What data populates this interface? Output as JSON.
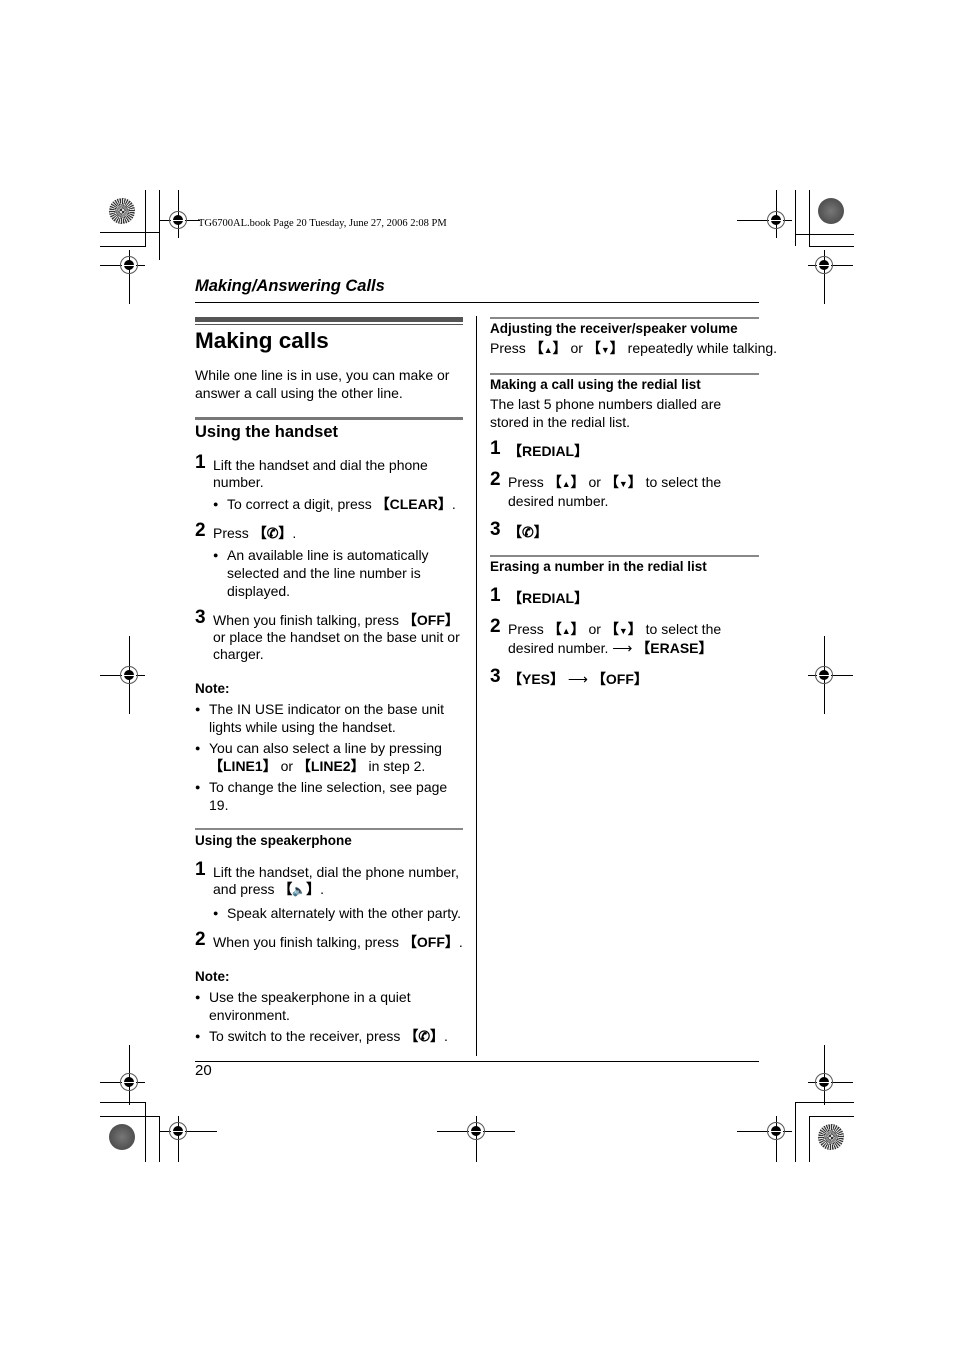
{
  "print_header": "TG6700AL.book  Page 20  Tuesday, June 27, 2006  2:08 PM",
  "section_title": "Making/Answering Calls",
  "page_title": "Making calls",
  "intro": "While one line is in use, you can make or answer a call using the other line.",
  "handset": {
    "heading": "Using the handset",
    "steps": [
      {
        "num": "1",
        "text": "Lift the handset and dial the phone number.",
        "bullets": [
          "To correct a digit, press [CLEAR]."
        ]
      },
      {
        "num": "2",
        "text": "Press [talk-key].",
        "bullets": [
          "An available line is automatically selected and the line number is displayed."
        ]
      },
      {
        "num": "3",
        "text": "When you finish talking, press [OFF] or place the handset on the base unit or charger.",
        "bullets": []
      }
    ],
    "note_label": "Note:",
    "notes": [
      "The IN USE indicator on the base unit lights while using the handset.",
      "You can also select a line by pressing [LINE1] or [LINE2] in step 2.",
      "To change the line selection, see page 19."
    ]
  },
  "speakerphone": {
    "heading": "Using the speakerphone",
    "steps": [
      {
        "num": "1",
        "text": "Lift the handset, dial the phone number, and press [speaker-key].",
        "bullets": [
          "Speak alternately with the other party."
        ]
      },
      {
        "num": "2",
        "text": "When you finish talking, press [OFF].",
        "bullets": []
      }
    ],
    "note_label": "Note:",
    "notes": [
      "Use the speakerphone in a quiet environment.",
      "To switch to the receiver, press [talk-key]."
    ]
  },
  "volume": {
    "heading": "Adjusting the receiver/speaker volume",
    "text": "Press [▲] or [▼] repeatedly while talking."
  },
  "redial": {
    "heading": "Making a call using the redial list",
    "text": "The last 5 phone numbers dialled are stored in the redial list.",
    "steps": [
      {
        "num": "1",
        "text": "[REDIAL]"
      },
      {
        "num": "2",
        "text": "Press [▲] or [▼] to select the desired number."
      },
      {
        "num": "3",
        "text": "[talk-key]"
      }
    ]
  },
  "erase": {
    "heading": "Erasing a number in the redial list",
    "steps": [
      {
        "num": "1",
        "text": "[REDIAL]"
      },
      {
        "num": "2",
        "text": "Press [▲] or [▼] to select the desired number. → [ERASE]"
      },
      {
        "num": "3",
        "text": "[YES] → [OFF]"
      }
    ]
  },
  "labels": {
    "clear": "CLEAR",
    "off": "OFF",
    "line1": "LINE1",
    "line2": "LINE2",
    "redial": "REDIAL",
    "erase": "ERASE",
    "yes": "YES",
    "up": "▲",
    "down": "▼",
    "talk_icon": "☎",
    "speaker_icon": "🔈"
  },
  "page_number": "20"
}
